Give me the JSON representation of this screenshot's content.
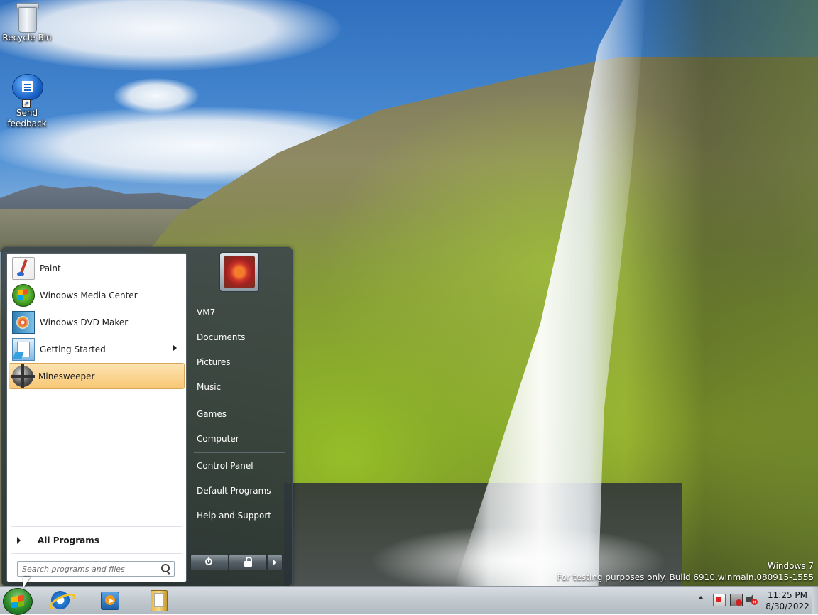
{
  "desktop": {
    "icons": [
      {
        "label": "Recycle Bin",
        "icon": "recycle-bin-icon"
      },
      {
        "label": "Send\nfeedback",
        "line1": "Send",
        "line2": "feedback",
        "icon": "feedback-icon"
      }
    ],
    "watermark": {
      "line1": "Windows  7",
      "line2": "For testing purposes only. Build 6910.winmain.080915-1555"
    }
  },
  "start_menu": {
    "programs": [
      {
        "label": "Paint",
        "icon": "paint-icon"
      },
      {
        "label": "Windows Media Center",
        "icon": "media-center-icon"
      },
      {
        "label": "Windows DVD Maker",
        "icon": "dvd-maker-icon"
      },
      {
        "label": "Getting Started",
        "icon": "getting-started-icon",
        "has_submenu": true
      },
      {
        "label": "Minesweeper",
        "icon": "minesweeper-icon",
        "selected": true
      }
    ],
    "all_programs_label": "All Programs",
    "search_placeholder": "Search programs and files",
    "right_items": [
      {
        "label": "VM7"
      },
      {
        "label": "Documents"
      },
      {
        "label": "Pictures"
      },
      {
        "label": "Music"
      },
      {
        "label": "Games"
      },
      {
        "label": "Computer"
      },
      {
        "label": "Control Panel"
      },
      {
        "label": "Default Programs"
      },
      {
        "label": "Help and Support"
      }
    ]
  },
  "taskbar": {
    "pinned": [
      "internet-explorer-icon",
      "windows-media-player-icon",
      "windows-explorer-icon"
    ],
    "clock": {
      "time": "11:25 PM",
      "date": "8/30/2022"
    }
  }
}
